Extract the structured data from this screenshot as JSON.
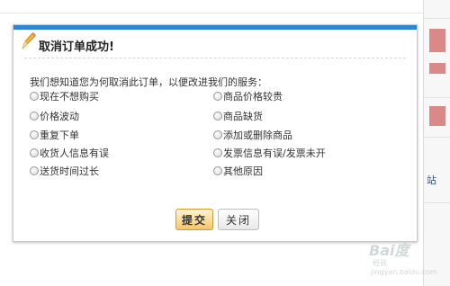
{
  "dialog": {
    "title": "取消订单成功!",
    "question": "我们想知道您为何取消此订单，以便改进我们的服务：",
    "options_left": [
      "现在不想购买",
      "价格波动",
      "重复下单",
      "收货人信息有误",
      "送货时间过长"
    ],
    "options_right": [
      "商品价格较贵",
      "商品缺货",
      "添加或删除商品",
      "发票信息有误/发票未开",
      "其他原因"
    ],
    "submit_label": "提交",
    "close_label": "关闭"
  },
  "side_panel": {
    "text": "站"
  },
  "watermark": {
    "logo": "Bai度",
    "sub": "经验",
    "url": "jingyan.baidu.com"
  },
  "colors": {
    "accent": "#2f86d0",
    "submit_bg": "#f6c66a"
  }
}
